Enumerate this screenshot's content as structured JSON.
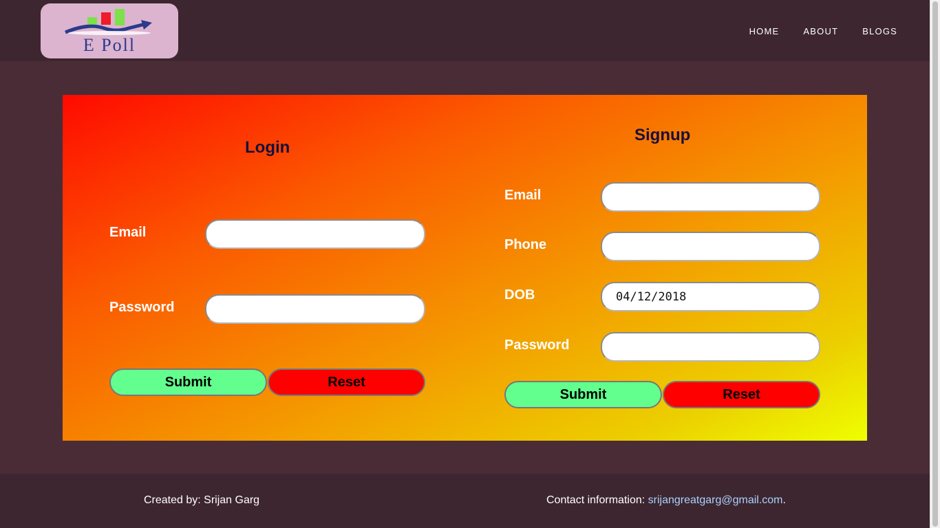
{
  "logo": {
    "text": "E Poll"
  },
  "nav": {
    "items": [
      "HOME",
      "ABOUT",
      "BLOGS"
    ]
  },
  "login": {
    "title": "Login",
    "email_label": "Email",
    "password_label": "Password",
    "email_value": "",
    "password_value": "",
    "submit_label": "Submit",
    "reset_label": "Reset"
  },
  "signup": {
    "title": "Signup",
    "email_label": "Email",
    "phone_label": "Phone",
    "dob_label": "DOB",
    "password_label": "Password",
    "email_value": "",
    "phone_value": "",
    "dob_value": "04/12/2018",
    "password_value": "",
    "submit_label": "Submit",
    "reset_label": "Reset"
  },
  "footer": {
    "credit": "Created by: Srijan Garg",
    "contact_prefix": "Contact information: ",
    "contact_email": "srijangreatgarg@gmail.com",
    "contact_suffix": "."
  },
  "colors": {
    "header_bg": "#3d262f",
    "page_bg": "#4a2c36",
    "submit": "#62ff8e",
    "reset": "#ff0000",
    "heading": "#1a0f3a"
  }
}
